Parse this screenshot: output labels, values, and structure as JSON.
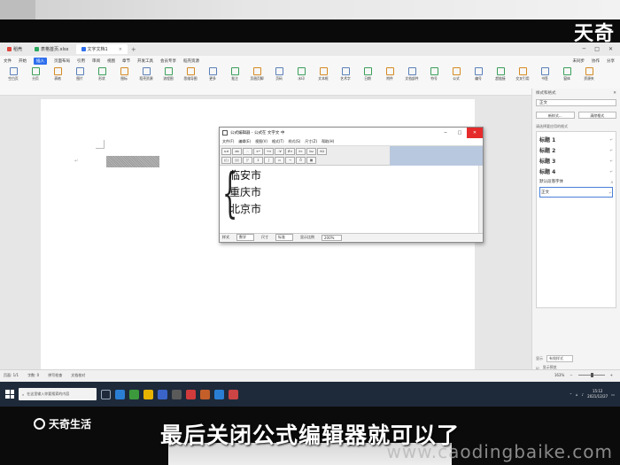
{
  "top_logo": "天奇",
  "tabs": [
    {
      "label": "稻壳",
      "color": "#e0443a"
    },
    {
      "label": "表格首页.xlsx",
      "color": "#2aa85d"
    },
    {
      "label": "文字文档1",
      "color": "#2f6fed",
      "active": true
    }
  ],
  "menu": {
    "left_items": [
      "文件",
      "开始",
      "插入",
      "页面布局",
      "引用",
      "审阅",
      "视图",
      "章节",
      "开发工具",
      "会员专享",
      "稻壳资源"
    ],
    "active_index": 1,
    "right_items": [
      "未同步",
      "协作",
      "分享"
    ]
  },
  "ribbon": {
    "items": [
      "空白页",
      "分页",
      "表格",
      "图片",
      "形状",
      "图标",
      "稻壳资源",
      "流程图",
      "思维导图",
      "更多",
      "批注",
      "页眉页脚",
      "页码",
      "水印",
      "文本框",
      "艺术字",
      "日期",
      "附件",
      "文档部件",
      "符号",
      "公式",
      "编号",
      "超链接",
      "交叉引用",
      "书签",
      "窗体",
      "资源夹"
    ]
  },
  "right_pane": {
    "title": "样式和格式",
    "current_style": "正文",
    "new_style_button": "新样式...",
    "clear_format_button": "清除格式",
    "apply_label": "请选择要应用的格式",
    "styles": [
      "标题 1",
      "标题 2",
      "标题 3",
      "标题 4"
    ],
    "default_font_item": "默认段落字体",
    "selected_item": "正文",
    "show_label": "显示",
    "show_value": "有效样式",
    "preview_label": "显示预览"
  },
  "status_bar": {
    "page": "页面: 1/1",
    "word_count": "字数: 0",
    "spell_check": "拼写检查",
    "doc_proof": "文档校对",
    "zoom": "163%"
  },
  "equation_editor": {
    "title": "公式编辑器 - 公式在 文字文 中",
    "menu": [
      "文件(F)",
      "编辑(E)",
      "视图(V)",
      "格式(T)",
      "样式(S)",
      "尺寸(Z)",
      "帮助(H)"
    ],
    "lines": [
      "临安市",
      "重庆市",
      "北京市"
    ],
    "status": {
      "style_label": "样式",
      "style_value": "数学",
      "size_label": "尺寸",
      "size_value": "标准",
      "zoom_label": "显示比例",
      "zoom_value": "200%"
    }
  },
  "taskbar": {
    "search_placeholder": "在这里输入你要搜索的内容",
    "time": "15:12",
    "date": "2021/12/27"
  },
  "brand": "天奇生活",
  "subtitle": "最后关闭公式编辑器就可以了",
  "watermark": "www.caodingbaike.com"
}
